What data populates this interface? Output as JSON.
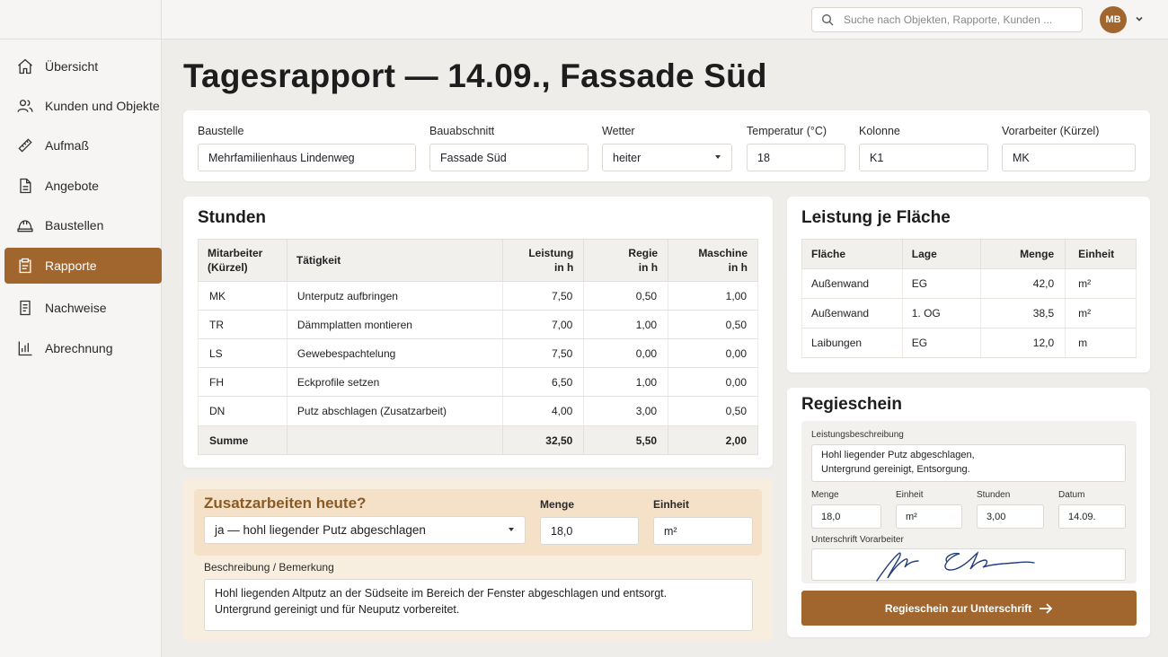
{
  "topbar": {
    "search_placeholder": "Suche nach Objekten, Rapporte, Kunden ...",
    "user_initials": "MB"
  },
  "sidebar": {
    "items": [
      {
        "label": "Übersicht",
        "icon": "home-icon"
      },
      {
        "label": "Kunden und Objekte",
        "icon": "users-icon"
      },
      {
        "label": "Aufmaß",
        "icon": "ruler-icon"
      },
      {
        "label": "Angebote",
        "icon": "document-icon"
      },
      {
        "label": "Baustellen",
        "icon": "helmet-icon"
      },
      {
        "label": "Rapporte",
        "icon": "clipboard-icon",
        "active": true
      },
      {
        "label": "Nachweise",
        "icon": "list-document-icon"
      },
      {
        "label": "Abrechnung",
        "icon": "bar-chart-icon"
      }
    ]
  },
  "page": {
    "title": "Tagesrapport — 14.09., Fassade Süd"
  },
  "header_fields": {
    "baustelle_label": "Baustelle",
    "baustelle_value": "Mehrfamilienhaus Lindenweg",
    "bauabschnitt_label": "Bauabschnitt",
    "bauabschnitt_value": "Fassade Süd",
    "wetter_label": "Wetter",
    "wetter_value": "heiter",
    "temperatur_label": "Temperatur (°C)",
    "temperatur_value": "18",
    "kolonne_label": "Kolonne",
    "kolonne_value": "K1",
    "vorarbeiter_label": "Vorarbeiter (Kürzel)",
    "vorarbeiter_value": "MK"
  },
  "stunden": {
    "title": "Stunden",
    "headers": {
      "mitarbeiter_1": "Mitarbeiter",
      "mitarbeiter_2": "(Kürzel)",
      "taetigkeit": "Tätigkeit",
      "leistung_1": "Leistung",
      "leistung_2": "in h",
      "regie_1": "Regie",
      "regie_2": "in h",
      "maschine_1": "Maschine",
      "maschine_2": "in h"
    },
    "rows": [
      {
        "kuerzel": "MK",
        "taetigkeit": "Unterputz aufbringen",
        "leistung": "7,50",
        "regie": "0,50",
        "maschine": "1,00"
      },
      {
        "kuerzel": "TR",
        "taetigkeit": "Dämmplatten montieren",
        "leistung": "7,00",
        "regie": "1,00",
        "maschine": "0,50"
      },
      {
        "kuerzel": "LS",
        "taetigkeit": "Gewebespachtelung",
        "leistung": "7,50",
        "regie": "0,00",
        "maschine": "0,00"
      },
      {
        "kuerzel": "FH",
        "taetigkeit": "Eckprofile setzen",
        "leistung": "6,50",
        "regie": "1,00",
        "maschine": "0,00"
      },
      {
        "kuerzel": "DN",
        "taetigkeit": "Putz abschlagen (Zusatzarbeit)",
        "leistung": "4,00",
        "regie": "3,00",
        "maschine": "0,50"
      }
    ],
    "sum": {
      "label": "Summe",
      "leistung": "32,50",
      "regie": "5,50",
      "maschine": "2,00"
    }
  },
  "flaeche": {
    "title": "Leistung je Fläche",
    "headers": {
      "flaeche": "Fläche",
      "lage": "Lage",
      "menge": "Menge",
      "einheit": "Einheit"
    },
    "rows": [
      {
        "flaeche": "Außenwand",
        "lage": "EG",
        "menge": "42,0",
        "einheit": "m²"
      },
      {
        "flaeche": "Außenwand",
        "lage": "1. OG",
        "menge": "38,5",
        "einheit": "m²"
      },
      {
        "flaeche": "Laibungen",
        "lage": "EG",
        "menge": "12,0",
        "einheit": "m"
      }
    ]
  },
  "zusatz": {
    "title": "Zusatzarbeiten heute?",
    "select_value": "ja — hohl liegender Putz abgeschlagen",
    "menge_label": "Menge",
    "menge_value": "18,0",
    "einheit_label": "Einheit",
    "einheit_value": "m²",
    "beschreibung_label": "Beschreibung / Bemerkung",
    "beschreibung_line1": "Hohl liegenden Altputz an der Südseite im Bereich der Fenster abgeschlagen und entsorgt.",
    "beschreibung_line2": "Untergrund gereinigt und für Neuputz vorbereitet."
  },
  "regieschein": {
    "title": "Regieschein",
    "leistung_label": "Leistungsbeschreibung",
    "leistung_line1": "Hohl liegender Putz abgeschlagen,",
    "leistung_line2": "Untergrund gereinigt, Entsorgung.",
    "menge_label": "Menge",
    "menge_value": "18,0",
    "einheit_label": "Einheit",
    "einheit_value": "m²",
    "stunden_label": "Stunden",
    "stunden_value": "3,00",
    "datum_label": "Datum",
    "datum_value": "14.09.",
    "unterschrift_label": "Unterschrift Vorarbeiter",
    "button_label": "Regieschein zur Unterschrift"
  },
  "colors": {
    "accent": "#a0662d",
    "accent_light": "#f4e1c8",
    "background": "#efedea"
  }
}
